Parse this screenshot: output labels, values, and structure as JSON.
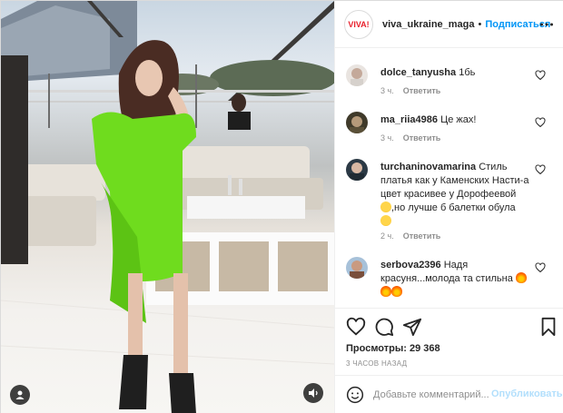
{
  "header": {
    "logo_text": "VIVA!",
    "username": "viva_ukraine_maga",
    "separator": "•",
    "follow_label": "Подписаться",
    "more_icon": "ellipsis-icon"
  },
  "comments": [
    {
      "username": "dolce_tanyusha",
      "text": "1бь",
      "time": "3 ч.",
      "reply": "Ответить"
    },
    {
      "username": "ma_riia4986",
      "text": "Це жах!",
      "time": "3 ч.",
      "reply": "Ответить"
    },
    {
      "username": "turchaninovamarina",
      "text_part1": "Стиль платья как у Каменских Насти-а цвет красивее у Дорофеевой",
      "text_part2": ",но лучше б балетки обула",
      "time": "2 ч.",
      "reply": "Ответить"
    },
    {
      "username": "serbova2396",
      "text": "Надя красуня...молода та стильна",
      "time": "3 ч.",
      "reply": "Ответить"
    }
  ],
  "actions": {
    "like_icon": "heart-icon",
    "comment_icon": "comment-icon",
    "share_icon": "paper-plane-icon",
    "save_icon": "bookmark-icon"
  },
  "stats": {
    "views_label": "Просмотры: 29 368",
    "time_ago": "3 ЧАСОВ НАЗАД"
  },
  "add_comment": {
    "placeholder": "Добавьте комментарий...",
    "post_label": "Опубликовать"
  },
  "colors": {
    "accent_blue": "#0095f6",
    "disabled_blue": "#b2dffc",
    "dress_green": "#6fdc1e",
    "logo_red": "#e8202c"
  }
}
